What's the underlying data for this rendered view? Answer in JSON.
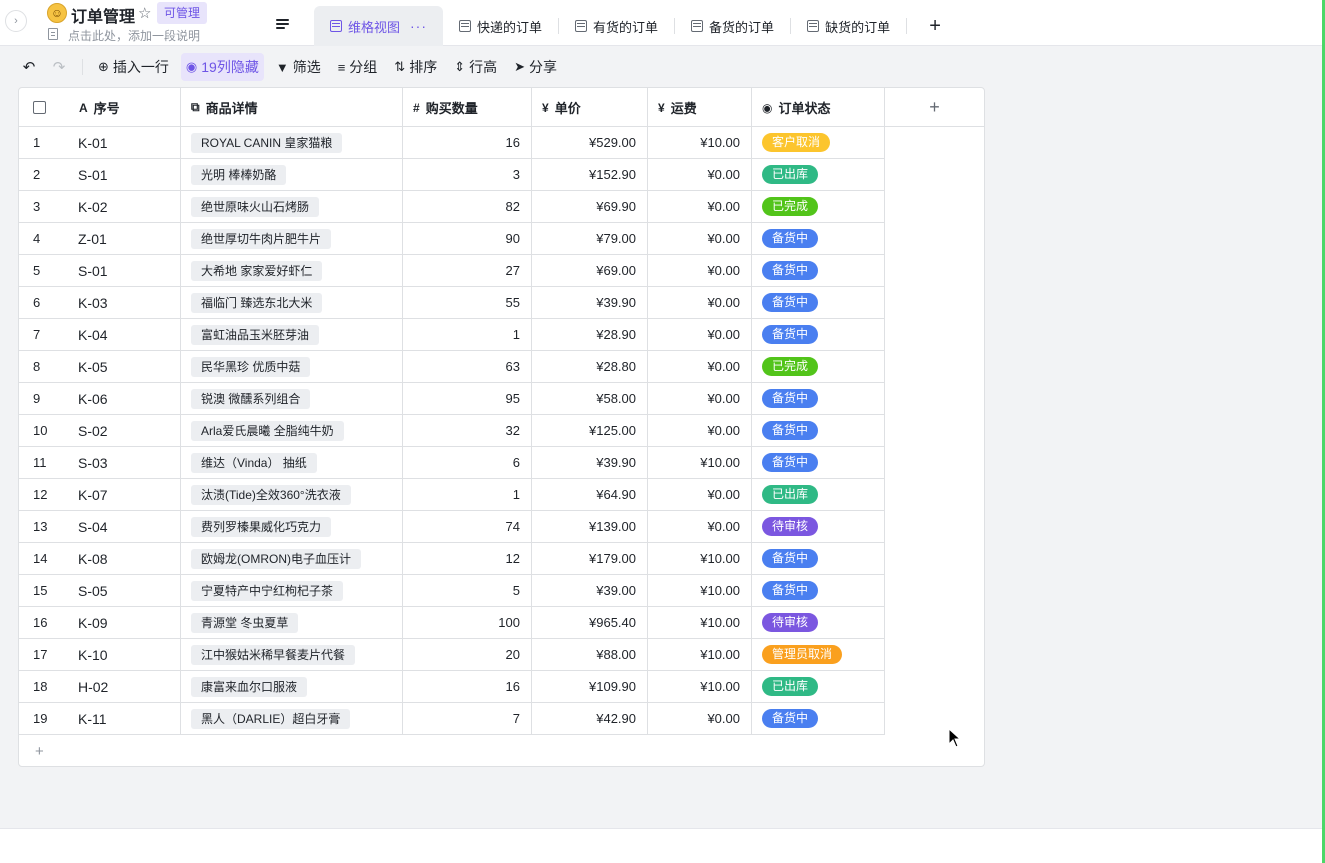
{
  "header": {
    "title": "订单管理",
    "badge": "可管理",
    "subtitle": "点击此处，添加一段说明"
  },
  "tabs": [
    {
      "label": "维格视图",
      "active": true
    },
    {
      "label": "快递的订单",
      "active": false
    },
    {
      "label": "有货的订单",
      "active": false
    },
    {
      "label": "备货的订单",
      "active": false
    },
    {
      "label": "缺货的订单",
      "active": false
    }
  ],
  "toolbar": {
    "insert_row": "插入一行",
    "hidden_cols": "19列隐藏",
    "filter": "筛选",
    "group": "分组",
    "sort": "排序",
    "row_height": "行高",
    "share": "分享"
  },
  "columns": {
    "code": "序号",
    "item": "商品详情",
    "qty": "购买数量",
    "price": "单价",
    "shipping": "运费",
    "status": "订单状态"
  },
  "status_colors": {
    "客户取消": "#fcc52d",
    "已出库": "#2fb985",
    "已完成": "#52c41a",
    "备货中": "#4a7ff0",
    "待审核": "#7b57e0",
    "管理员取消": "#faa01e"
  },
  "rows": [
    {
      "n": "1",
      "code": "K-01",
      "item": "ROYAL CANIN 皇家猫粮",
      "qty": "16",
      "price": "¥529.00",
      "ship": "¥10.00",
      "status": "客户取消"
    },
    {
      "n": "2",
      "code": "S-01",
      "item": "光明 棒棒奶酪",
      "qty": "3",
      "price": "¥152.90",
      "ship": "¥0.00",
      "status": "已出库"
    },
    {
      "n": "3",
      "code": "K-02",
      "item": "绝世原味火山石烤肠",
      "qty": "82",
      "price": "¥69.90",
      "ship": "¥0.00",
      "status": "已完成"
    },
    {
      "n": "4",
      "code": "Z-01",
      "item": "绝世厚切牛肉片肥牛片",
      "qty": "90",
      "price": "¥79.00",
      "ship": "¥0.00",
      "status": "备货中"
    },
    {
      "n": "5",
      "code": "S-01",
      "item": "大希地 家家爱好虾仁",
      "qty": "27",
      "price": "¥69.00",
      "ship": "¥0.00",
      "status": "备货中"
    },
    {
      "n": "6",
      "code": "K-03",
      "item": "福临门 臻选东北大米",
      "qty": "55",
      "price": "¥39.90",
      "ship": "¥0.00",
      "status": "备货中"
    },
    {
      "n": "7",
      "code": "K-04",
      "item": "富虹油品玉米胚芽油",
      "qty": "1",
      "price": "¥28.90",
      "ship": "¥0.00",
      "status": "备货中"
    },
    {
      "n": "8",
      "code": "K-05",
      "item": "民华黑珍 优质中菇",
      "qty": "63",
      "price": "¥28.80",
      "ship": "¥0.00",
      "status": "已完成"
    },
    {
      "n": "9",
      "code": "K-06",
      "item": "锐澳 微醺系列组合",
      "qty": "95",
      "price": "¥58.00",
      "ship": "¥0.00",
      "status": "备货中"
    },
    {
      "n": "10",
      "code": "S-02",
      "item": "Arla爱氏晨曦 全脂纯牛奶",
      "qty": "32",
      "price": "¥125.00",
      "ship": "¥0.00",
      "status": "备货中"
    },
    {
      "n": "11",
      "code": "S-03",
      "item": "维达（Vinda） 抽纸",
      "qty": "6",
      "price": "¥39.90",
      "ship": "¥10.00",
      "status": "备货中"
    },
    {
      "n": "12",
      "code": "K-07",
      "item": "汰渍(Tide)全效360°洗衣液",
      "qty": "1",
      "price": "¥64.90",
      "ship": "¥0.00",
      "status": "已出库"
    },
    {
      "n": "13",
      "code": "S-04",
      "item": "费列罗榛果威化巧克力",
      "qty": "74",
      "price": "¥139.00",
      "ship": "¥0.00",
      "status": "待审核"
    },
    {
      "n": "14",
      "code": "K-08",
      "item": "欧姆龙(OMRON)电子血压计",
      "qty": "12",
      "price": "¥179.00",
      "ship": "¥10.00",
      "status": "备货中"
    },
    {
      "n": "15",
      "code": "S-05",
      "item": "宁夏特产中宁红枸杞子茶",
      "qty": "5",
      "price": "¥39.00",
      "ship": "¥10.00",
      "status": "备货中"
    },
    {
      "n": "16",
      "code": "K-09",
      "item": "青源堂 冬虫夏草",
      "qty": "100",
      "price": "¥965.40",
      "ship": "¥10.00",
      "status": "待审核"
    },
    {
      "n": "17",
      "code": "K-10",
      "item": "江中猴姑米稀早餐麦片代餐",
      "qty": "20",
      "price": "¥88.00",
      "ship": "¥10.00",
      "status": "管理员取消"
    },
    {
      "n": "18",
      "code": "H-02",
      "item": "康富来血尔口服液",
      "qty": "16",
      "price": "¥109.90",
      "ship": "¥10.00",
      "status": "已出库"
    },
    {
      "n": "19",
      "code": "K-11",
      "item": "黑人（DARLIE）超白牙膏",
      "qty": "7",
      "price": "¥42.90",
      "ship": "¥0.00",
      "status": "备货中"
    }
  ]
}
